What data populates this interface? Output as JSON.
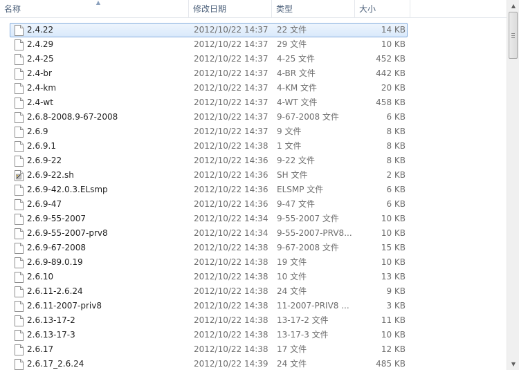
{
  "columns": {
    "name": "名称",
    "date": "修改日期",
    "type": "类型",
    "size": "大小"
  },
  "sort_indicator": "▲",
  "scrollbar": {
    "up": "▲",
    "down": "▼"
  },
  "rows": [
    {
      "name": "2.4.22",
      "date": "2012/10/22 14:37",
      "type": "22 文件",
      "size": "14 KB",
      "icon": "blank-file-icon",
      "selected": true
    },
    {
      "name": "2.4.29",
      "date": "2012/10/22 14:37",
      "type": "29 文件",
      "size": "10 KB",
      "icon": "blank-file-icon"
    },
    {
      "name": "2.4-25",
      "date": "2012/10/22 14:37",
      "type": "4-25 文件",
      "size": "452 KB",
      "icon": "blank-file-icon"
    },
    {
      "name": "2.4-br",
      "date": "2012/10/22 14:37",
      "type": "4-BR 文件",
      "size": "442 KB",
      "icon": "blank-file-icon"
    },
    {
      "name": "2.4-km",
      "date": "2012/10/22 14:37",
      "type": "4-KM 文件",
      "size": "20 KB",
      "icon": "blank-file-icon"
    },
    {
      "name": "2.4-wt",
      "date": "2012/10/22 14:37",
      "type": "4-WT 文件",
      "size": "458 KB",
      "icon": "blank-file-icon"
    },
    {
      "name": "2.6.8-2008.9-67-2008",
      "date": "2012/10/22 14:37",
      "type": "9-67-2008 文件",
      "size": "6 KB",
      "icon": "blank-file-icon"
    },
    {
      "name": "2.6.9",
      "date": "2012/10/22 14:37",
      "type": "9 文件",
      "size": "8 KB",
      "icon": "blank-file-icon"
    },
    {
      "name": "2.6.9.1",
      "date": "2012/10/22 14:38",
      "type": "1 文件",
      "size": "8 KB",
      "icon": "blank-file-icon"
    },
    {
      "name": "2.6.9-22",
      "date": "2012/10/22 14:36",
      "type": "9-22 文件",
      "size": "8 KB",
      "icon": "blank-file-icon"
    },
    {
      "name": "2.6.9-22.sh",
      "date": "2012/10/22 14:36",
      "type": "SH 文件",
      "size": "2 KB",
      "icon": "script-file-icon"
    },
    {
      "name": "2.6.9-42.0.3.ELsmp",
      "date": "2012/10/22 14:36",
      "type": "ELSMP 文件",
      "size": "6 KB",
      "icon": "blank-file-icon"
    },
    {
      "name": "2.6.9-47",
      "date": "2012/10/22 14:36",
      "type": "9-47 文件",
      "size": "6 KB",
      "icon": "blank-file-icon"
    },
    {
      "name": "2.6.9-55-2007",
      "date": "2012/10/22 14:34",
      "type": "9-55-2007 文件",
      "size": "10 KB",
      "icon": "blank-file-icon"
    },
    {
      "name": "2.6.9-55-2007-prv8",
      "date": "2012/10/22 14:34",
      "type": "9-55-2007-PRV8...",
      "size": "10 KB",
      "icon": "blank-file-icon"
    },
    {
      "name": "2.6.9-67-2008",
      "date": "2012/10/22 14:38",
      "type": "9-67-2008 文件",
      "size": "15 KB",
      "icon": "blank-file-icon"
    },
    {
      "name": "2.6.9-89.0.19",
      "date": "2012/10/22 14:38",
      "type": "19 文件",
      "size": "10 KB",
      "icon": "blank-file-icon"
    },
    {
      "name": "2.6.10",
      "date": "2012/10/22 14:38",
      "type": "10 文件",
      "size": "13 KB",
      "icon": "blank-file-icon"
    },
    {
      "name": "2.6.11-2.6.24",
      "date": "2012/10/22 14:38",
      "type": "24 文件",
      "size": "9 KB",
      "icon": "blank-file-icon"
    },
    {
      "name": "2.6.11-2007-priv8",
      "date": "2012/10/22 14:38",
      "type": "11-2007-PRIV8 ...",
      "size": "3 KB",
      "icon": "blank-file-icon"
    },
    {
      "name": "2.6.13-17-2",
      "date": "2012/10/22 14:38",
      "type": "13-17-2 文件",
      "size": "11 KB",
      "icon": "blank-file-icon"
    },
    {
      "name": "2.6.13-17-3",
      "date": "2012/10/22 14:38",
      "type": "13-17-3 文件",
      "size": "10 KB",
      "icon": "blank-file-icon"
    },
    {
      "name": "2.6.17",
      "date": "2012/10/22 14:38",
      "type": "17 文件",
      "size": "12 KB",
      "icon": "blank-file-icon"
    },
    {
      "name": "2.6.17_2.6.24",
      "date": "2012/10/22 14:39",
      "type": "24 文件",
      "size": "485 KB",
      "icon": "blank-file-icon"
    }
  ]
}
